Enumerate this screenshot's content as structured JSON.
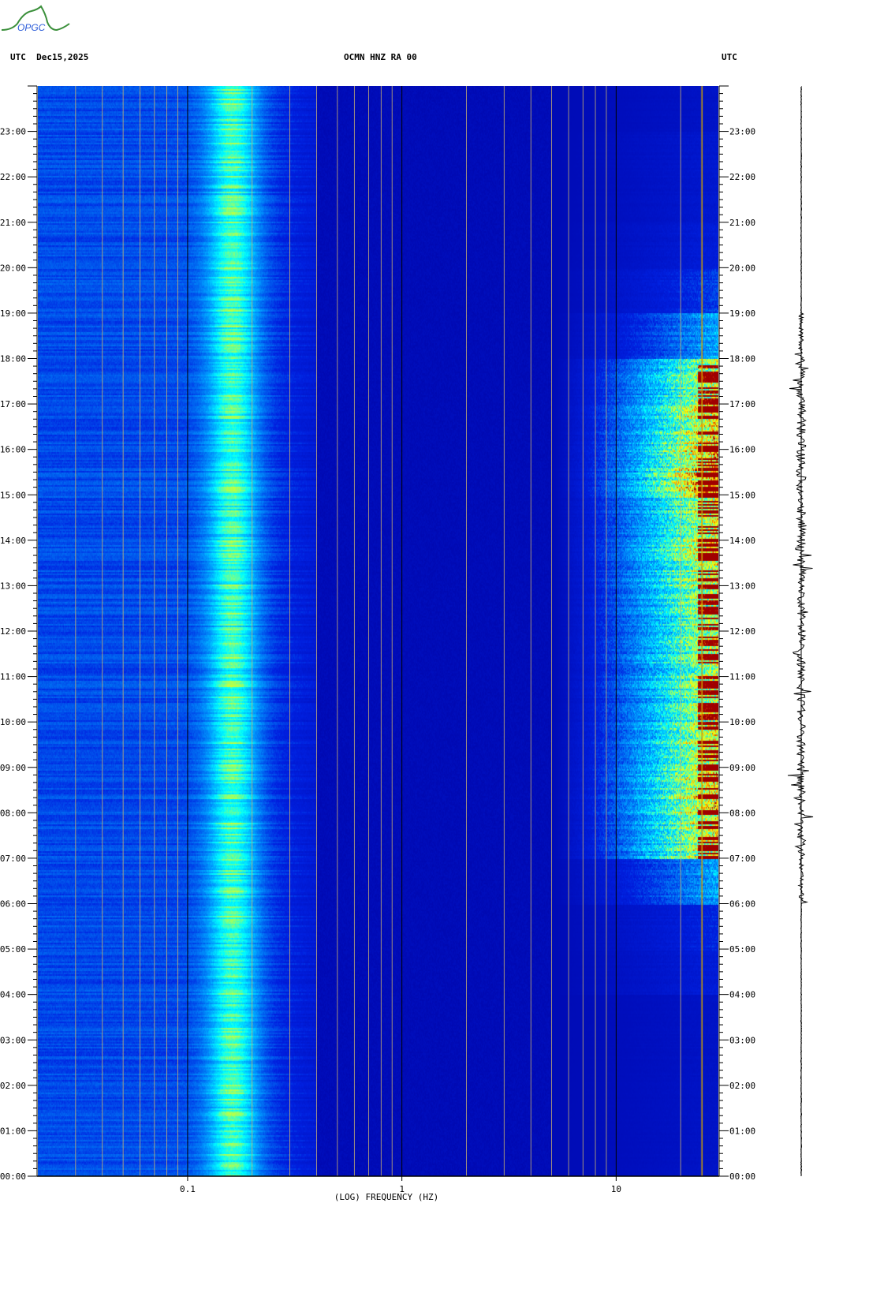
{
  "header": {
    "left": "UTC  Dec15,2025",
    "center": "OCMN HNZ RA 00",
    "right": "UTC"
  },
  "logo": {
    "text": "OPGC"
  },
  "colors": {
    "low": "#0000a0",
    "mid": "#00a0ff",
    "high": "#ffff00",
    "max": "#a00000",
    "logo_green": "#3a8f3a",
    "logo_blue": "#2a5bd8"
  },
  "chart_data": {
    "type": "heatmap",
    "title": "OCMN HNZ RA 00",
    "date": "Dec15,2025",
    "timezone": "UTC",
    "xlabel": "(LOG) FREQUENCY (HZ)",
    "xscale": "log",
    "xlim": [
      0.02,
      30
    ],
    "xticks": [
      {
        "value": 0.1,
        "label": "0.1"
      },
      {
        "value": 1,
        "label": "1"
      },
      {
        "value": 10,
        "label": "10"
      }
    ],
    "ylim_hours": [
      0,
      24
    ],
    "yticks": [
      "00:00",
      "01:00",
      "02:00",
      "03:00",
      "04:00",
      "05:00",
      "06:00",
      "07:00",
      "08:00",
      "09:00",
      "10:00",
      "11:00",
      "12:00",
      "13:00",
      "14:00",
      "15:00",
      "16:00",
      "17:00",
      "18:00",
      "19:00",
      "20:00",
      "21:00",
      "22:00",
      "23:00"
    ],
    "colormap": [
      "#0000a0",
      "#0020e0",
      "#00a0ff",
      "#00ffff",
      "#a0ff60",
      "#ffff00",
      "#ff8000",
      "#a00000"
    ],
    "microseism_peak_hz": [
      0.13,
      0.2
    ],
    "high_freq_band_hz": [
      5,
      30
    ],
    "narrowband_line_hz": 25,
    "hourly_high_freq_activity": [
      0.1,
      0.1,
      0.1,
      0.1,
      0.2,
      0.25,
      0.5,
      0.9,
      0.95,
      0.9,
      0.85,
      0.85,
      0.85,
      0.9,
      0.9,
      1.0,
      0.95,
      0.85,
      0.5,
      0.3,
      0.2,
      0.15,
      0.15,
      0.1
    ]
  }
}
